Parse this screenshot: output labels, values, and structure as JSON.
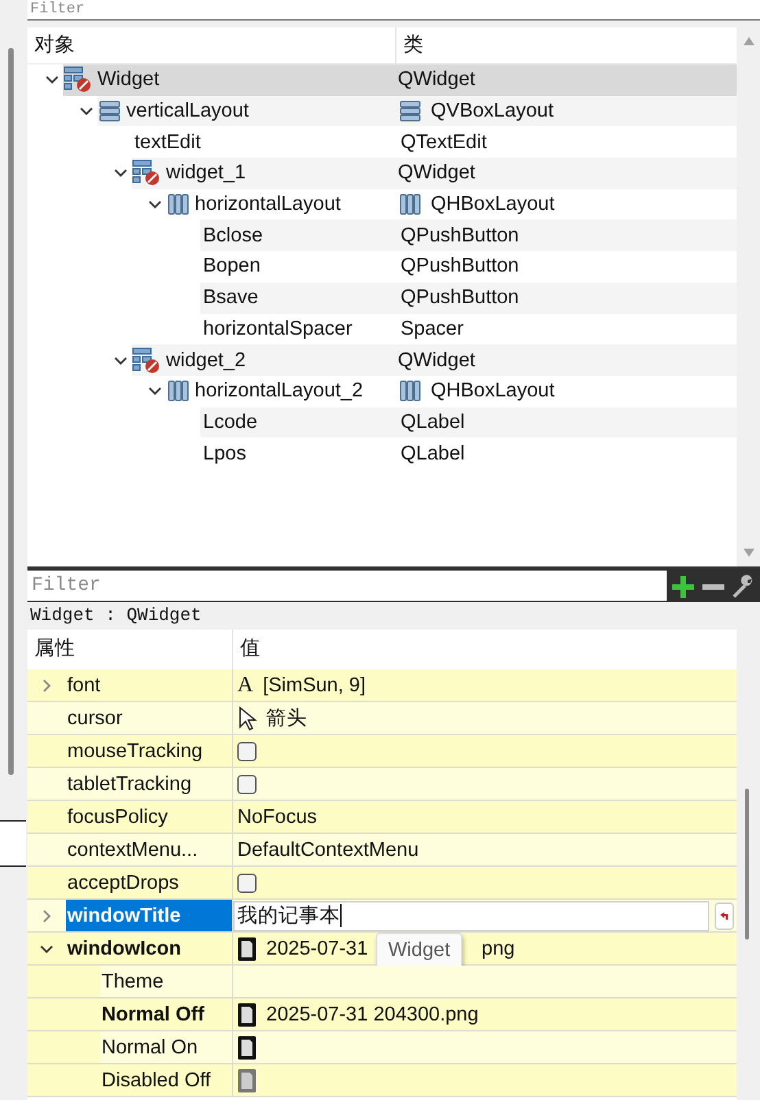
{
  "object_filter": {
    "placeholder": "Filter"
  },
  "object_tree": {
    "columns": [
      "对象",
      "类"
    ],
    "items": [
      {
        "name": "Widget",
        "class": "QWidget",
        "kind": "widget",
        "selected": true,
        "expanded": true,
        "children": [
          {
            "name": "verticalLayout",
            "class": "QVBoxLayout",
            "kind": "vbox",
            "selected": false,
            "expanded": true,
            "children": [
              {
                "name": "textEdit",
                "class": "QTextEdit",
                "selected": false
              },
              {
                "name": "widget_1",
                "class": "QWidget",
                "kind": "widget",
                "selected": false,
                "expanded": true,
                "children": [
                  {
                    "name": "horizontalLayout",
                    "class": "QHBoxLayout",
                    "kind": "hbox",
                    "selected": false,
                    "expanded": true,
                    "children": [
                      {
                        "name": "Bclose",
                        "class": "QPushButton",
                        "selected": false
                      },
                      {
                        "name": "Bopen",
                        "class": "QPushButton",
                        "selected": false
                      },
                      {
                        "name": "Bsave",
                        "class": "QPushButton",
                        "selected": false
                      },
                      {
                        "name": "horizontalSpacer",
                        "class": "Spacer",
                        "selected": false
                      }
                    ]
                  }
                ]
              },
              {
                "name": "widget_2",
                "class": "QWidget",
                "kind": "widget",
                "selected": false,
                "expanded": true,
                "children": [
                  {
                    "name": "horizontalLayout_2",
                    "class": "QHBoxLayout",
                    "kind": "hbox",
                    "selected": false,
                    "expanded": true,
                    "children": [
                      {
                        "name": "Lcode",
                        "class": "QLabel",
                        "selected": false
                      },
                      {
                        "name": "Lpos",
                        "class": "QLabel",
                        "selected": false
                      }
                    ]
                  }
                ]
              }
            ]
          }
        ]
      }
    ]
  },
  "property_filter": {
    "placeholder": "Filter"
  },
  "property_toolbar": [
    {
      "kind": "add"
    },
    {
      "kind": "remove"
    },
    {
      "kind": "configure"
    }
  ],
  "object_label": "Widget : QWidget",
  "properties": {
    "columns": [
      "属性",
      "值"
    ],
    "rows": [
      {
        "name": "font",
        "kind": "font",
        "icon_glyph": "A",
        "value": "[SimSun, 9]",
        "expanded": false,
        "modified": false,
        "selected": false
      },
      {
        "name": "cursor",
        "kind": "cursor",
        "value": "箭头",
        "modified": false,
        "selected": false
      },
      {
        "name": "mouseTracking",
        "kind": "checkbox",
        "checked": false,
        "modified": false,
        "selected": false
      },
      {
        "name": "tabletTracking",
        "kind": "checkbox",
        "checked": false,
        "modified": false,
        "selected": false
      },
      {
        "name": "focusPolicy",
        "kind": "text",
        "value": "NoFocus",
        "modified": false,
        "selected": false
      },
      {
        "name": "contextMenu...",
        "kind": "text",
        "value": "DefaultContextMenu",
        "modified": false,
        "selected": false
      },
      {
        "name": "acceptDrops",
        "kind": "checkbox",
        "checked": false,
        "modified": false,
        "selected": false
      },
      {
        "name": "windowTitle",
        "kind": "edit",
        "value": "我的记事本",
        "expanded": false,
        "modified": true,
        "selected": true
      },
      {
        "name": "windowIcon",
        "kind": "icon",
        "value": "2025-07-31",
        "value_tail": "png",
        "tooltip": "Widget",
        "expanded": true,
        "modified": true,
        "selected": false,
        "children": [
          {
            "name": "Theme",
            "kind": "text",
            "modified": false,
            "selected": false
          },
          {
            "name": "Normal Off",
            "kind": "icon",
            "value": "2025-07-31 204300.png",
            "modified": true,
            "selected": false
          },
          {
            "name": "Normal On",
            "kind": "icon",
            "modified": false,
            "selected": false
          },
          {
            "name": "Disabled Off",
            "kind": "icon",
            "disabled": true,
            "modified": false,
            "selected": false
          }
        ]
      }
    ]
  }
}
